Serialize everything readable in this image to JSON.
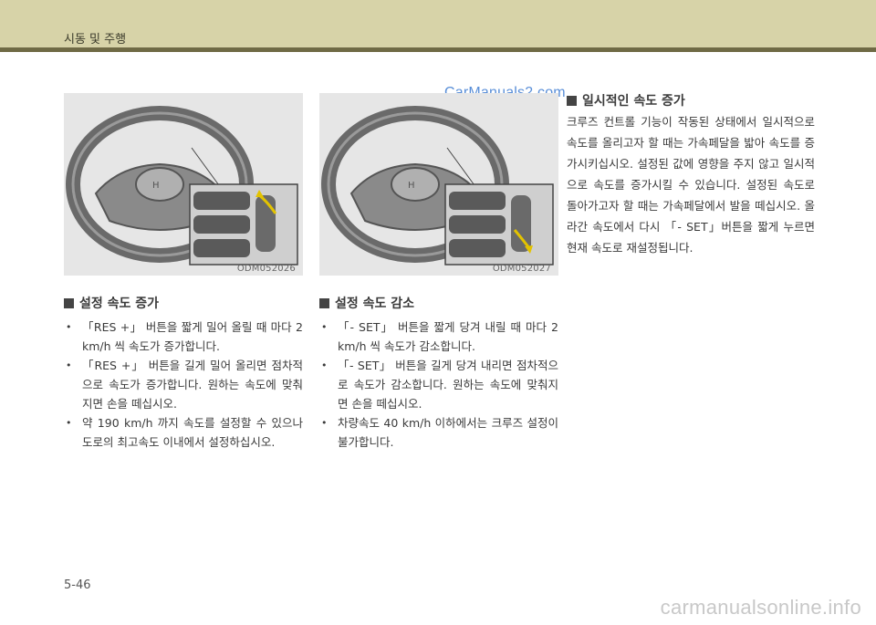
{
  "header": {
    "title": "시동 및 주행"
  },
  "watermarks": {
    "top": "CarManuals2.com",
    "bottom": "carmanualsonline.info"
  },
  "figures": [
    {
      "code": "ODM052026",
      "icon": "steering-wheel-res-up-illustration"
    },
    {
      "code": "ODM052027",
      "icon": "steering-wheel-set-down-illustration"
    }
  ],
  "sections": [
    {
      "title": "설정 속도 증가",
      "bullets": [
        "「RES +」 버튼을 짧게 밀어 올릴 때 마다 2 km/h 씩 속도가 증가합니다.",
        "「RES +」 버튼을 길게 밀어 올리면 점차적으로 속도가 증가합니다. 원하는 속도에 맞춰지면 손을 떼십시오.",
        "약 190 km/h 까지 속도를 설정할 수 있으나 도로의 최고속도 이내에서 설정하십시오."
      ]
    },
    {
      "title": "설정 속도 감소",
      "bullets": [
        "「- SET」 버튼을 짧게 당겨 내릴 때 마다 2 km/h 씩 속도가 감소합니다.",
        "「- SET」 버튼을 길게 당겨 내리면 점차적으로 속도가 감소합니다. 원하는 속도에 맞춰지면 손을 떼십시오.",
        "차량속도 40 km/h 이하에서는 크루즈 설정이 불가합니다."
      ]
    },
    {
      "title": "일시적인 속도 증가",
      "paragraph": "크루즈 컨트롤 기능이 작동된 상태에서 일시적으로 속도를 올리고자 할 때는 가속페달을 밟아 속도를 증가시키십시오. 설정된 값에 영향을 주지 않고 일시적으로 속도를 증가시킬 수 있습니다. 설정된 속도로 돌아가고자 할 때는 가속페달에서 발을 떼십시오. 올라간 속도에서 다시 「- SET」버튼을 짧게 누르면 현재 속도로 재설정됩니다."
    }
  ],
  "footer": {
    "page_number": "5-46"
  }
}
